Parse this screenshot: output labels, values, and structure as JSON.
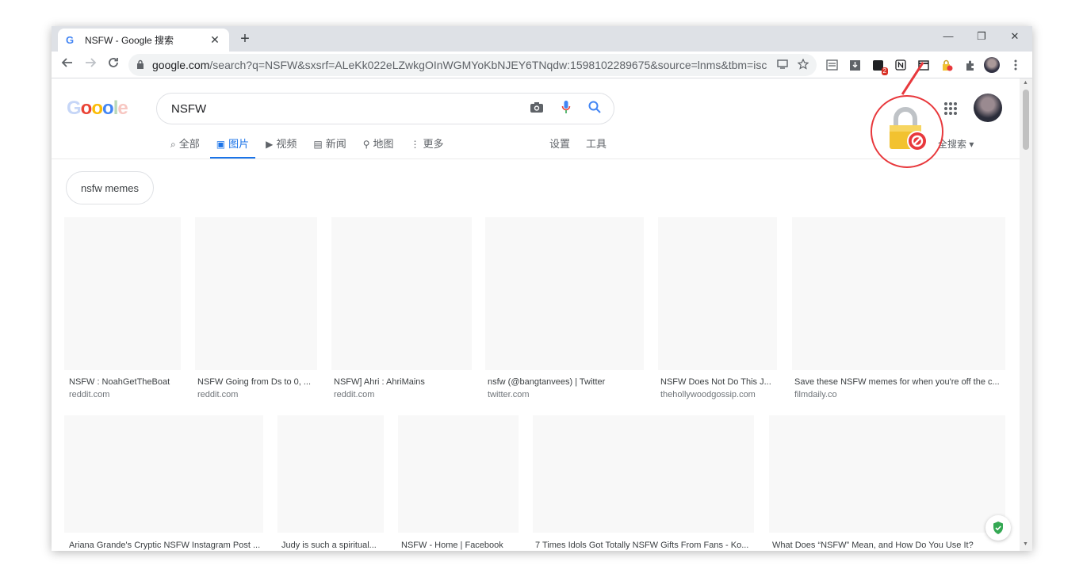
{
  "browser": {
    "tab_title": "NSFW - Google 搜索",
    "tab_favicon": "G",
    "tab_close": "✕",
    "new_tab": "+",
    "minimize": "—",
    "restore": "❐",
    "close": "✕"
  },
  "toolbar": {
    "url_host": "google.com",
    "url_rest": "/search?q=NSFW&sxsrf=ALeKk022eLZwkgOInWGMYoKbNJEY6TNqdw:1598102289675&source=lnms&tbm=isch...",
    "ext_badge": "2"
  },
  "search": {
    "logo_letters": [
      "G",
      "o",
      "o",
      "o",
      "l",
      "e"
    ],
    "query": "NSFW",
    "tabs": [
      {
        "icon": "⌕",
        "label": "全部"
      },
      {
        "icon": "▣",
        "label": "图片"
      },
      {
        "icon": "▶",
        "label": "视频"
      },
      {
        "icon": "▤",
        "label": "新闻"
      },
      {
        "icon": "⚲",
        "label": "地图"
      },
      {
        "icon": "⋮",
        "label": "更多"
      }
    ],
    "settings_label": "设置",
    "tools_label": "工具",
    "safesearch_label": "全搜索 ▾",
    "chip_label": "nsfw memes"
  },
  "results_row1": [
    {
      "title": "NSFW : NoahGetTheBoat",
      "source": "reddit.com"
    },
    {
      "title": "NSFW Going from Ds to 0, ...",
      "source": "reddit.com"
    },
    {
      "title": "NSFW] Ahri : AhriMains",
      "source": "reddit.com"
    },
    {
      "title": "nsfw (@bangtanvees) | Twitter",
      "source": "twitter.com"
    },
    {
      "title": "NSFW Does Not Do This J...",
      "source": "thehollywoodgossip.com"
    },
    {
      "title": "Save these NSFW memes for when you're off the c...",
      "source": "filmdaily.co"
    }
  ],
  "results_row2": [
    {
      "title": "Ariana Grande's Cryptic NSFW Instagram Post ..."
    },
    {
      "title": "Judy is such a spiritual..."
    },
    {
      "title": "NSFW - Home | Facebook"
    },
    {
      "title": "7 Times Idols Got Totally NSFW Gifts From Fans - Ko..."
    },
    {
      "title": "What Does “NSFW” Mean, and How Do You Use It?"
    }
  ],
  "colors": {
    "accent": "#1a73e8",
    "annotation": "#e8383c",
    "lock": "#f2c230",
    "block_badge": "#e8383c"
  },
  "icons": [
    "back-icon",
    "forward-icon",
    "reload-icon",
    "lock-icon",
    "cast-icon",
    "star-icon",
    "extensions-icon",
    "camera-icon",
    "mic-icon",
    "search-icon",
    "apps-icon",
    "shield-check-icon",
    "padlock-blocked-icon"
  ]
}
